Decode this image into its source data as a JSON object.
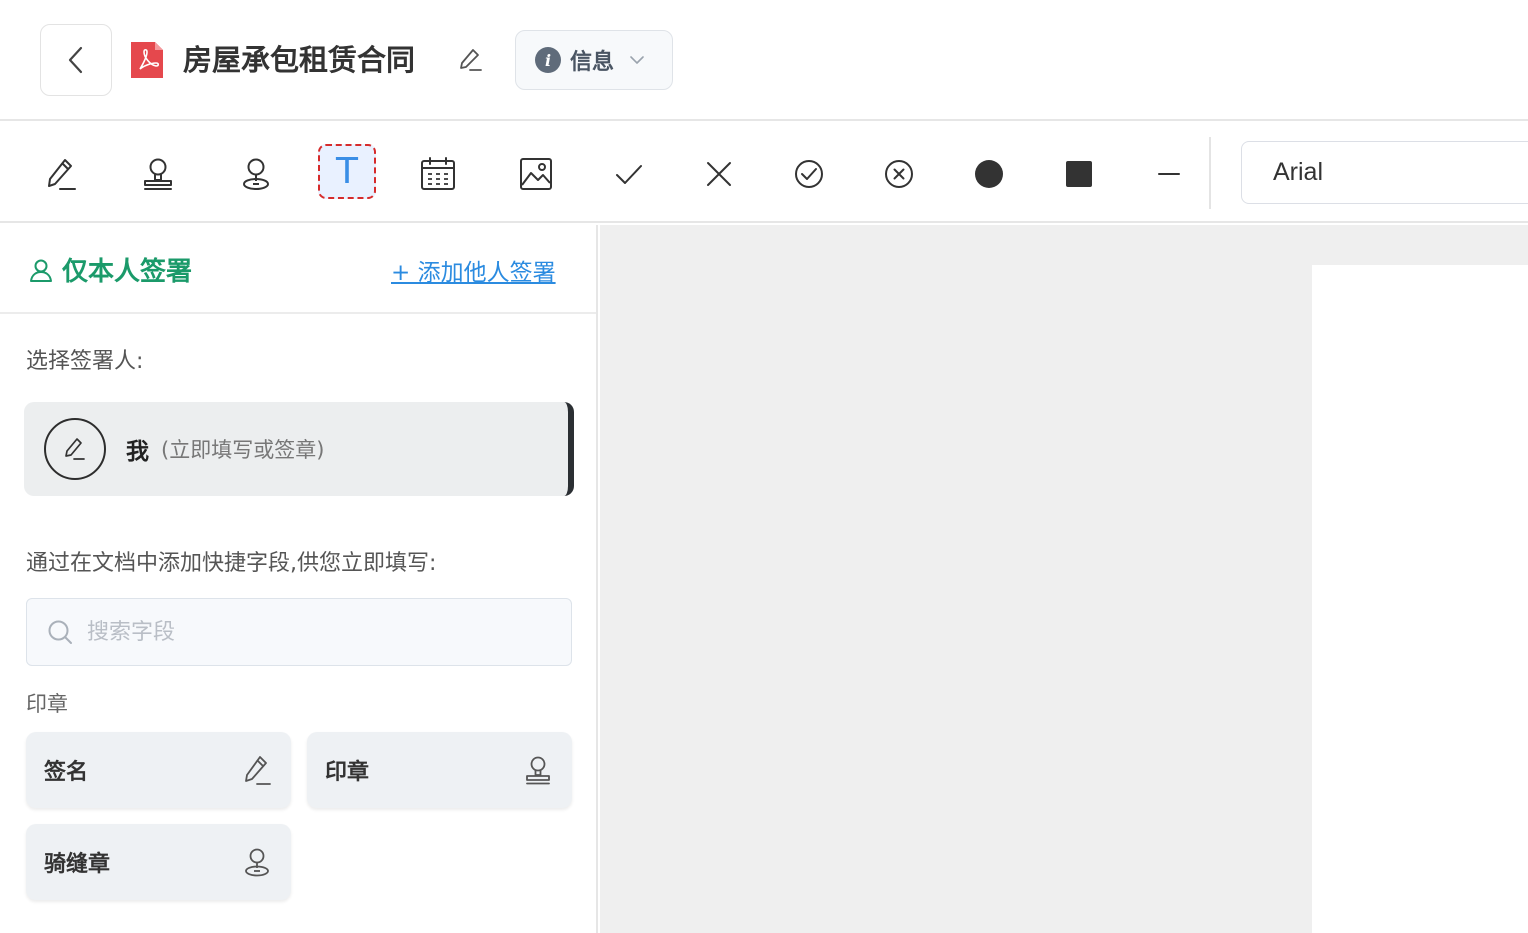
{
  "header": {
    "title": "房屋承包租赁合同",
    "info_label": "信息",
    "back_icon": "chevron-left-icon",
    "file_icon": "pdf-icon"
  },
  "toolbar": {
    "tools": [
      {
        "name": "signature-tool",
        "icon": "pen-icon"
      },
      {
        "name": "stamp-tool",
        "icon": "stamp-icon"
      },
      {
        "name": "seam-stamp-tool",
        "icon": "seam-stamp-icon"
      },
      {
        "name": "text-tool",
        "icon": "text-icon",
        "glyph": "T",
        "active": true
      },
      {
        "name": "date-tool",
        "icon": "calendar-icon"
      },
      {
        "name": "image-tool",
        "icon": "image-icon"
      },
      {
        "name": "check-tool",
        "icon": "check-icon"
      },
      {
        "name": "cross-tool",
        "icon": "cross-icon"
      },
      {
        "name": "circle-check-tool",
        "icon": "circle-check-icon"
      },
      {
        "name": "circle-cross-tool",
        "icon": "circle-cross-icon"
      },
      {
        "name": "dot-tool",
        "icon": "filled-circle-icon"
      },
      {
        "name": "square-tool",
        "icon": "filled-square-icon"
      },
      {
        "name": "line-tool",
        "icon": "line-icon"
      }
    ],
    "font_value": "Arial"
  },
  "sidebar": {
    "mode_label": "仅本人签署",
    "add_others_label": "+ 添加他人签署",
    "select_signer_label": "选择签署人:",
    "signer": {
      "name": "我",
      "note": "(立即填写或签章)"
    },
    "quick_fields_label": "通过在文档中添加快捷字段,供您立即填写:",
    "search_placeholder": "搜索字段",
    "stamp_section_label": "印章",
    "fields": [
      {
        "label": "签名",
        "icon": "pen-icon"
      },
      {
        "label": "印章",
        "icon": "stamp-icon"
      },
      {
        "label": "骑缝章",
        "icon": "seam-stamp-icon"
      }
    ]
  },
  "colors": {
    "accent_green": "#1b9a6a",
    "link_blue": "#2b8be0",
    "active_outline": "#d62b2b",
    "canvas_bg": "#efefef"
  }
}
